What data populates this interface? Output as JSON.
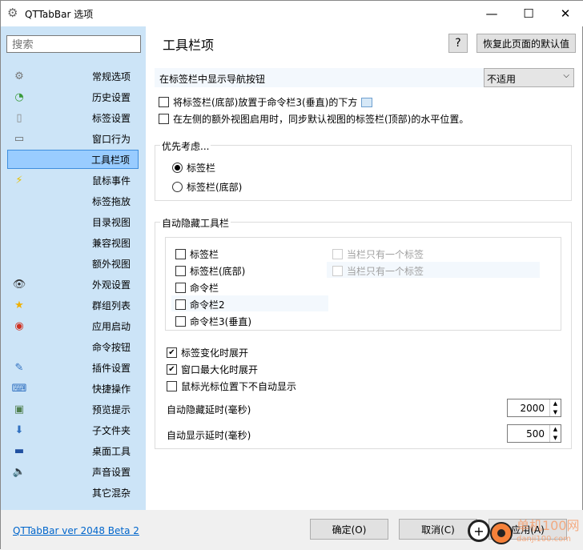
{
  "window": {
    "title": "QTTabBar 选项",
    "minimize": "—",
    "maximize": "☐",
    "close": "✕"
  },
  "sidebar": {
    "search_placeholder": "搜索",
    "items": [
      {
        "label": "常规选项",
        "icon": "gear-icon"
      },
      {
        "label": "历史设置",
        "icon": "history-icon"
      },
      {
        "label": "标签设置",
        "icon": "tabs-icon"
      },
      {
        "label": "窗口行为",
        "icon": "window-icon"
      },
      {
        "label": "工具栏项",
        "icon": "",
        "selected": true
      },
      {
        "label": "鼠标事件",
        "icon": "lightning-icon"
      },
      {
        "label": "标签拖放",
        "icon": ""
      },
      {
        "label": "目录视图",
        "icon": ""
      },
      {
        "label": "兼容视图",
        "icon": ""
      },
      {
        "label": "额外视图",
        "icon": ""
      },
      {
        "label": "外观设置",
        "icon": "eye-icon"
      },
      {
        "label": "群组列表",
        "icon": "star-icon"
      },
      {
        "label": "应用启动",
        "icon": "app-icon"
      },
      {
        "label": "命令按钮",
        "icon": ""
      },
      {
        "label": "插件设置",
        "icon": "plugin-icon"
      },
      {
        "label": "快捷操作",
        "icon": "keyboard-icon"
      },
      {
        "label": "预览提示",
        "icon": "preview-icon"
      },
      {
        "label": "子文件夹",
        "icon": "subfolder-icon"
      },
      {
        "label": "桌面工具",
        "icon": "desktop-icon"
      },
      {
        "label": "声音设置",
        "icon": "speaker-icon"
      },
      {
        "label": "其它混杂",
        "icon": ""
      }
    ]
  },
  "main": {
    "title": "工具栏项",
    "help": "?",
    "reset": "恢复此页面的默认值",
    "nav_label": "在标签栏中显示导航按钮",
    "nav_value": "不适用",
    "opt1": "将标签栏(底部)放置于命令栏3(垂直)的下方",
    "opt2": "在左侧的额外视图启用时，同步默认视图的标签栏(顶部)的水平位置。",
    "priority": {
      "label": "优先考虑...",
      "options": [
        {
          "label": "标签栏",
          "checked": true
        },
        {
          "label": "标签栏(底部)",
          "checked": false
        }
      ]
    },
    "autohide": {
      "label": "自动隐藏工具栏",
      "bars": [
        {
          "label": "标签栏",
          "checked": false
        },
        {
          "label": "标签栏(底部)",
          "checked": false
        },
        {
          "label": "命令栏",
          "checked": false
        },
        {
          "label": "命令栏2",
          "checked": false
        },
        {
          "label": "命令栏3(垂直)",
          "checked": false
        }
      ],
      "only_one": [
        "当栏只有一个标签",
        "当栏只有一个标签"
      ],
      "expand": [
        {
          "label": "标签变化时展开",
          "checked": true
        },
        {
          "label": "窗口最大化时展开",
          "checked": true
        },
        {
          "label": "鼠标光标位置下不自动显示",
          "checked": false
        }
      ],
      "hide_delay_label": "自动隐藏延时(毫秒)",
      "hide_delay": "2000",
      "show_delay_label": "自动显示延时(毫秒)",
      "show_delay": "500"
    }
  },
  "footer": {
    "version": "QTTabBar ver 2048 Beta 2",
    "ok": "确定(O)",
    "cancel": "取消(C)",
    "apply": "应用(A)"
  },
  "watermark": {
    "text": "单机100网",
    "url": "danji100.com"
  }
}
